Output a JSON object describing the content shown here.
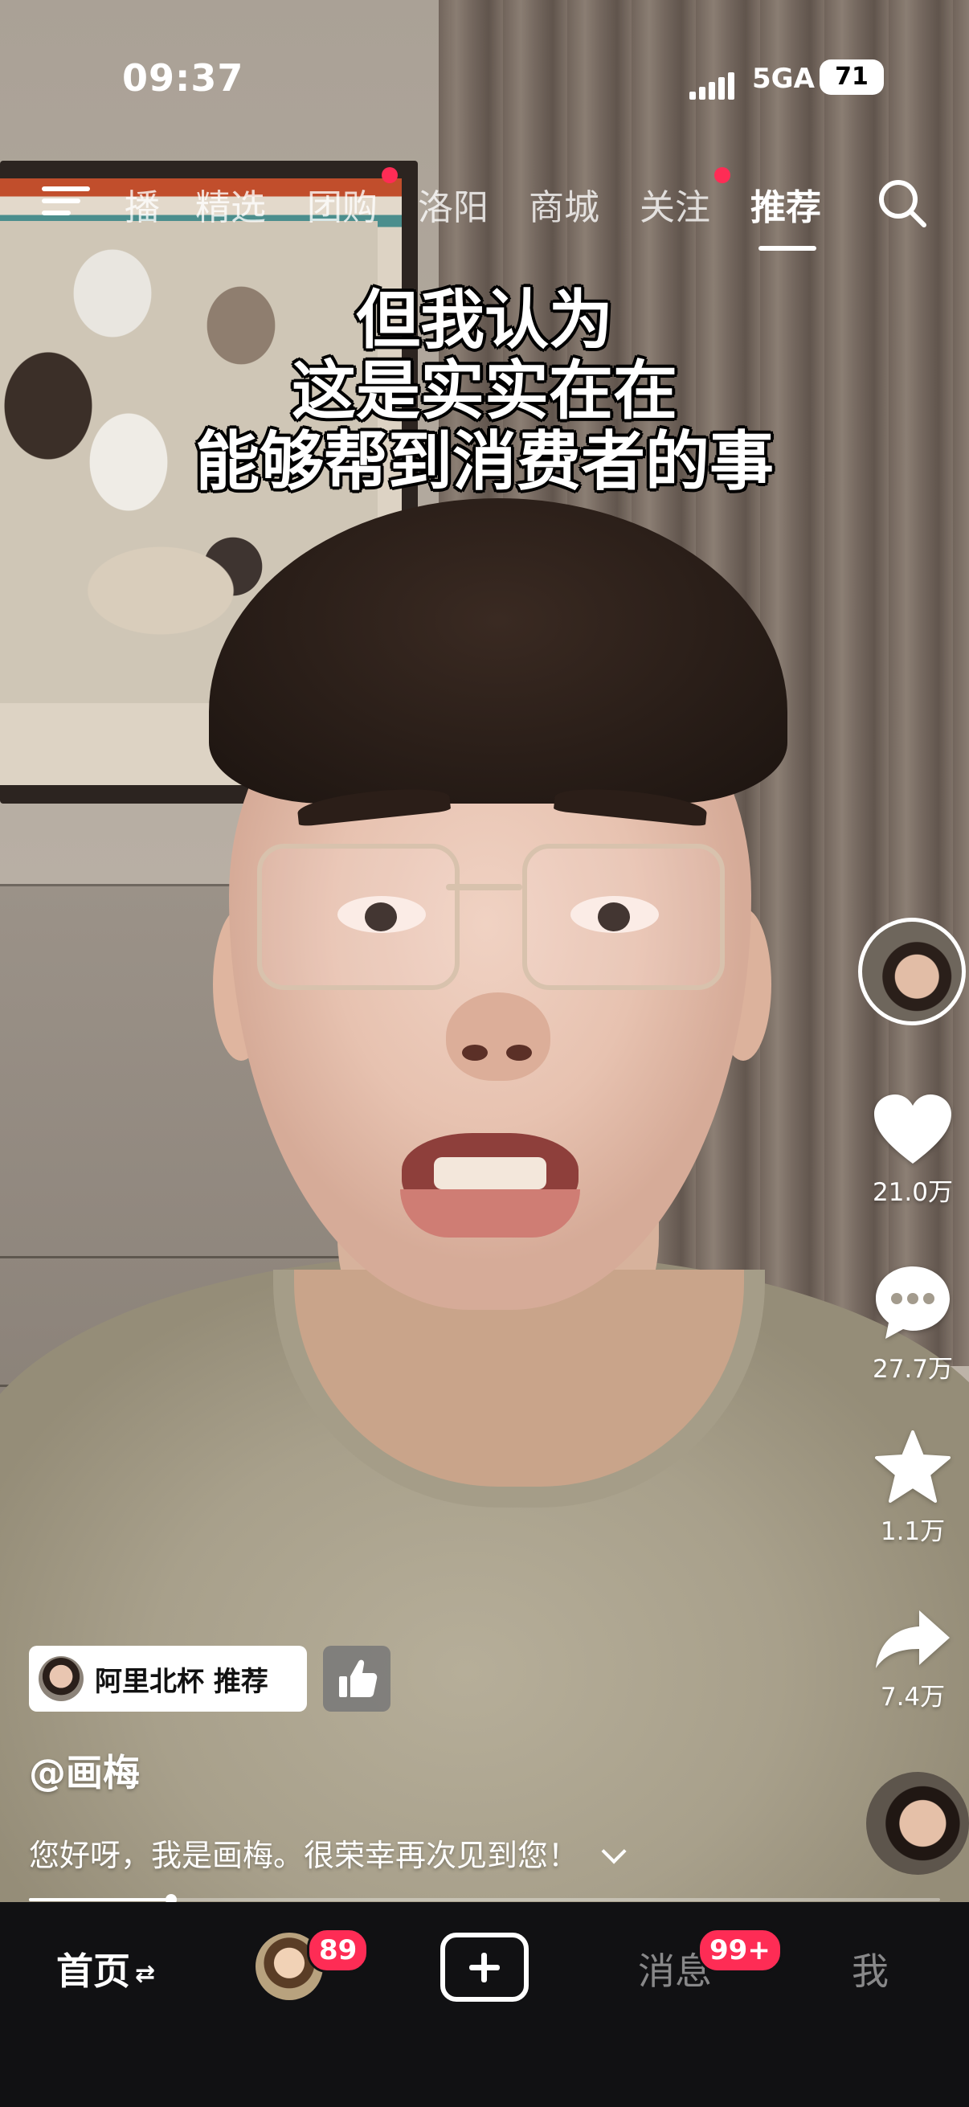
{
  "status_bar": {
    "time": "09:37",
    "network": "5GA",
    "battery": "71"
  },
  "top_nav": {
    "tabs": [
      {
        "label": "播",
        "dot": false
      },
      {
        "label": "精选",
        "dot": false
      },
      {
        "label": "团购",
        "dot": true
      },
      {
        "label": "洛阳",
        "dot": false
      },
      {
        "label": "商城",
        "dot": false
      },
      {
        "label": "关注",
        "dot": true
      },
      {
        "label": "推荐",
        "dot": false,
        "active": true
      }
    ]
  },
  "subtitle": {
    "lines": [
      "但我认为",
      "这是实实在在",
      "能够帮到消费者的事"
    ]
  },
  "actions": {
    "likes": "21.0万",
    "comments": "27.7万",
    "favorites": "1.1万",
    "shares": "7.4万"
  },
  "recommend_chip": {
    "label": "阿里北杯 推荐"
  },
  "video_info": {
    "author": "@画梅",
    "description": "您好呀，我是画梅。很荣幸再次见到您！",
    "progress": 0.156
  },
  "bottom_nav": {
    "home": "首页",
    "home_swap": "⇄",
    "friend_badge": "89",
    "messages": "消息",
    "messages_badge": "99+",
    "me": "我"
  },
  "colors": {
    "accent_red": "#fe2c55",
    "nav_bg": "#111113"
  },
  "icons": [
    "menu-icon",
    "search-icon",
    "heart-icon",
    "comment-icon",
    "star-icon",
    "share-icon",
    "thumbs-up-icon",
    "chevron-down-icon",
    "plus-icon"
  ]
}
